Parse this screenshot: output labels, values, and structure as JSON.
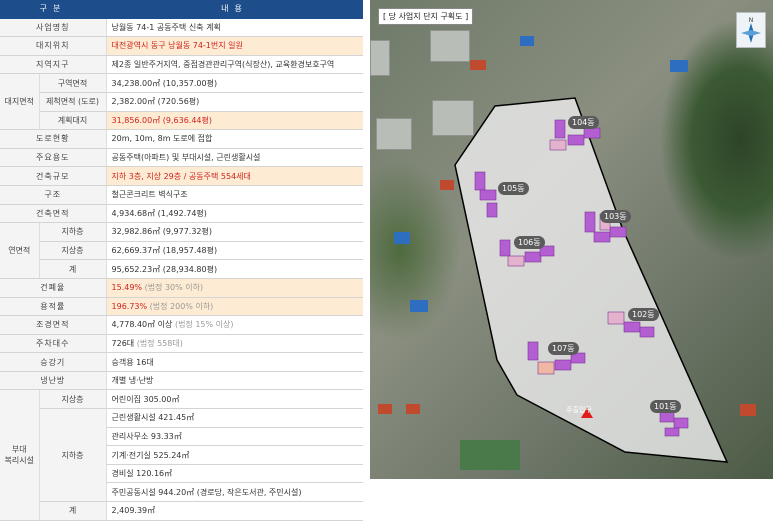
{
  "table": {
    "header": {
      "col1": "구분",
      "col2": "내용"
    },
    "rows": {
      "name": {
        "label": "사업명칭",
        "value": "낭월동 74-1 공동주택 신축 계획"
      },
      "location": {
        "label": "대지위치",
        "value": "대전광역시 동구 낭월동 74-1번지 일원"
      },
      "zone": {
        "label": "지역지구",
        "value": "제2종 일반주거지역, 중점경관관리구역(식장산), 교육환경보호구역"
      },
      "site_area_group": "대지면적",
      "site_area": {
        "label": "구역면적",
        "value": "34,238.00㎡ (10,357.00평)"
      },
      "excluded_area": {
        "label": "제척면적 (도로)",
        "value": "2,382.00㎡ (720.56평)"
      },
      "planned_site": {
        "label": "계획대지",
        "value": "31,856.00㎡ (9,636.44평)"
      },
      "road": {
        "label": "도로현황",
        "value": "20m, 10m, 8m 도로에 접합"
      },
      "use": {
        "label": "주요용도",
        "value": "공동주택(아파트) 및 부대시설, 근린생활시설"
      },
      "scale": {
        "label": "건축규모",
        "value": "지하 3층, 지상 29층 / 공동주택 554세대"
      },
      "structure": {
        "label": "구조",
        "value": "철근콘크리트 벽식구조"
      },
      "building_area": {
        "label": "건축면적",
        "value": "4,934.68㎡ (1,492.74평)"
      },
      "floor_area_group": "연면적",
      "underground": {
        "label": "지하층",
        "value": "32,982.86㎡ (9,977.32평)"
      },
      "above": {
        "label": "지상층",
        "value": "62,669.37㎡ (18,957.48평)"
      },
      "floor_total": {
        "label": "계",
        "value": "95,652.23㎡ (28,934.80평)"
      },
      "coverage": {
        "label": "건폐율",
        "value": "15.49%",
        "note": "(법정 30% 이하)"
      },
      "far": {
        "label": "용적률",
        "value": "196.73%",
        "note": "(법정 200% 이하)"
      },
      "landscape": {
        "label": "조경면적",
        "value": "4,778.40㎡ 이상",
        "note": "(법정 15% 이상)"
      },
      "parking": {
        "label": "주차대수",
        "value": "726대",
        "note": "(법정 558대)"
      },
      "elevator": {
        "label": "승강기",
        "value": "승객용 16대"
      },
      "heating": {
        "label": "냉난방",
        "value": "개별 냉·난방"
      },
      "welfare_group": "부대\n복리시설",
      "welfare_above": {
        "label": "지상층",
        "value": "어린이집 305.00㎡"
      },
      "welfare_under_label": "지하층",
      "welfare_under": [
        "근린생활시설 421.45㎡",
        "관리사무소 93.33㎡",
        "기계·전기실 525.24㎡",
        "경비실 120.16㎡",
        "주민공동시설 944.20㎡ (경로당, 작은도서관, 주민시설)"
      ],
      "welfare_total": {
        "label": "계",
        "value": "2,409.39㎡"
      }
    }
  },
  "map": {
    "title": "[ 당 사업지 단지 구획도 ]",
    "compass": "compass-icon",
    "buildings": [
      "104동",
      "105동",
      "103동",
      "106동",
      "102동",
      "107동",
      "101동"
    ],
    "entrance": "주출입구"
  }
}
